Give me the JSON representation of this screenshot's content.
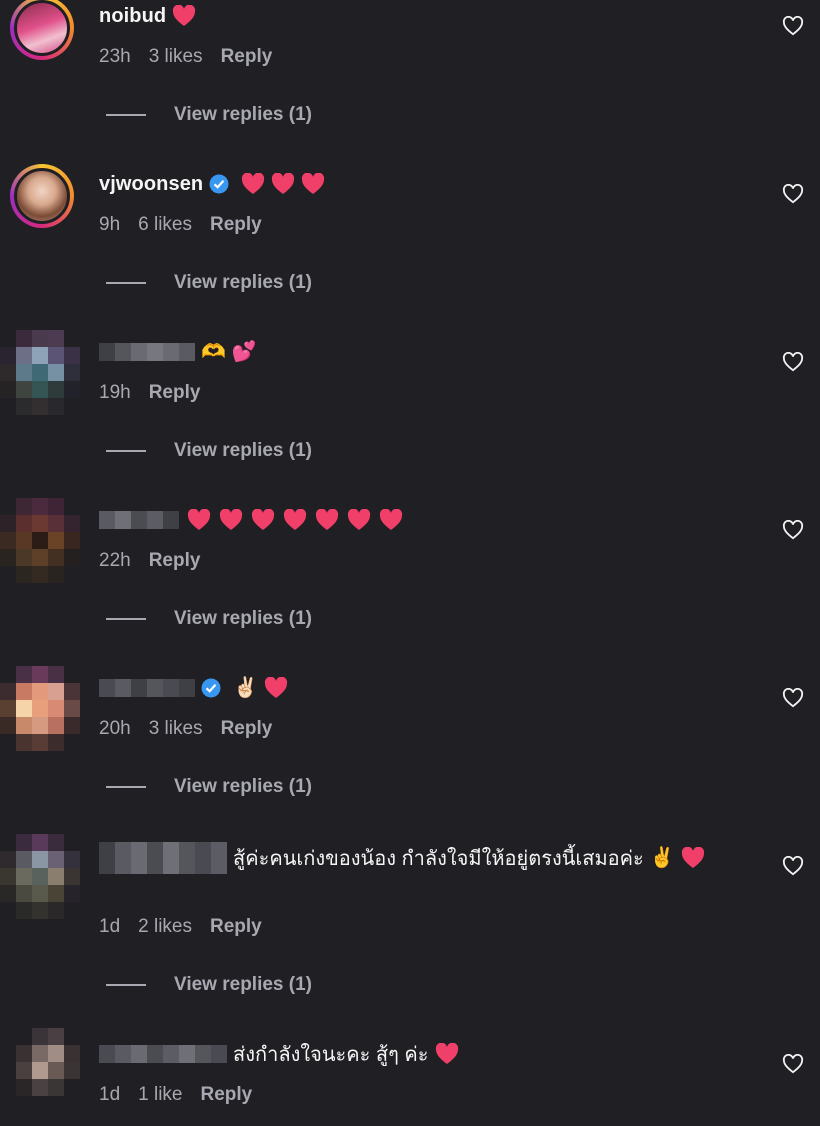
{
  "comments": [
    {
      "username": "noibud",
      "text": "",
      "emoji": [
        "heart"
      ],
      "time": "23h",
      "likes": "3 likes",
      "reply": "Reply",
      "view_replies": "View replies (1)",
      "verified": false,
      "blurred": false
    },
    {
      "username": "vjwoonsen",
      "text": "",
      "emoji": [
        "heart",
        "heart",
        "heart"
      ],
      "time": "9h",
      "likes": "6 likes",
      "reply": "Reply",
      "view_replies": "View replies (1)",
      "verified": true,
      "blurred": false
    },
    {
      "username": "",
      "text": "",
      "emoji": [
        "heart-hands",
        "two-hearts"
      ],
      "time": "19h",
      "likes": "",
      "reply": "Reply",
      "view_replies": "View replies (1)",
      "verified": false,
      "blurred": true
    },
    {
      "username": "",
      "text": "",
      "emoji": [
        "heart",
        "heart",
        "heart",
        "heart",
        "heart",
        "heart",
        "heart"
      ],
      "time": "22h",
      "likes": "",
      "reply": "Reply",
      "view_replies": "View replies (1)",
      "verified": false,
      "blurred": true
    },
    {
      "username": "",
      "text": "",
      "emoji": [
        "victory",
        "heart"
      ],
      "time": "20h",
      "likes": "3 likes",
      "reply": "Reply",
      "view_replies": "View replies (1)",
      "verified": true,
      "blurred": true
    },
    {
      "username": "",
      "text": "สู้ค่ะคนเก่งของน้อง กำลังใจมีให้อยู่ตรงนี้เสมอค่ะ",
      "emoji": [
        "victory",
        "heart"
      ],
      "time": "1d",
      "likes": "2 likes",
      "reply": "Reply",
      "view_replies": "View replies (1)",
      "verified": false,
      "blurred": true
    },
    {
      "username": "",
      "text": "ส่งกำลังใจนะคะ สู้ๆ ค่ะ",
      "emoji": [
        "heart"
      ],
      "time": "1d",
      "likes": "1 like",
      "reply": "Reply",
      "view_replies": "",
      "verified": false,
      "blurred": true
    }
  ],
  "colors": {
    "background": "#1f1f24",
    "heart": "#f0406a",
    "verified": "#3897f0",
    "meta": "#a8a8b0"
  }
}
